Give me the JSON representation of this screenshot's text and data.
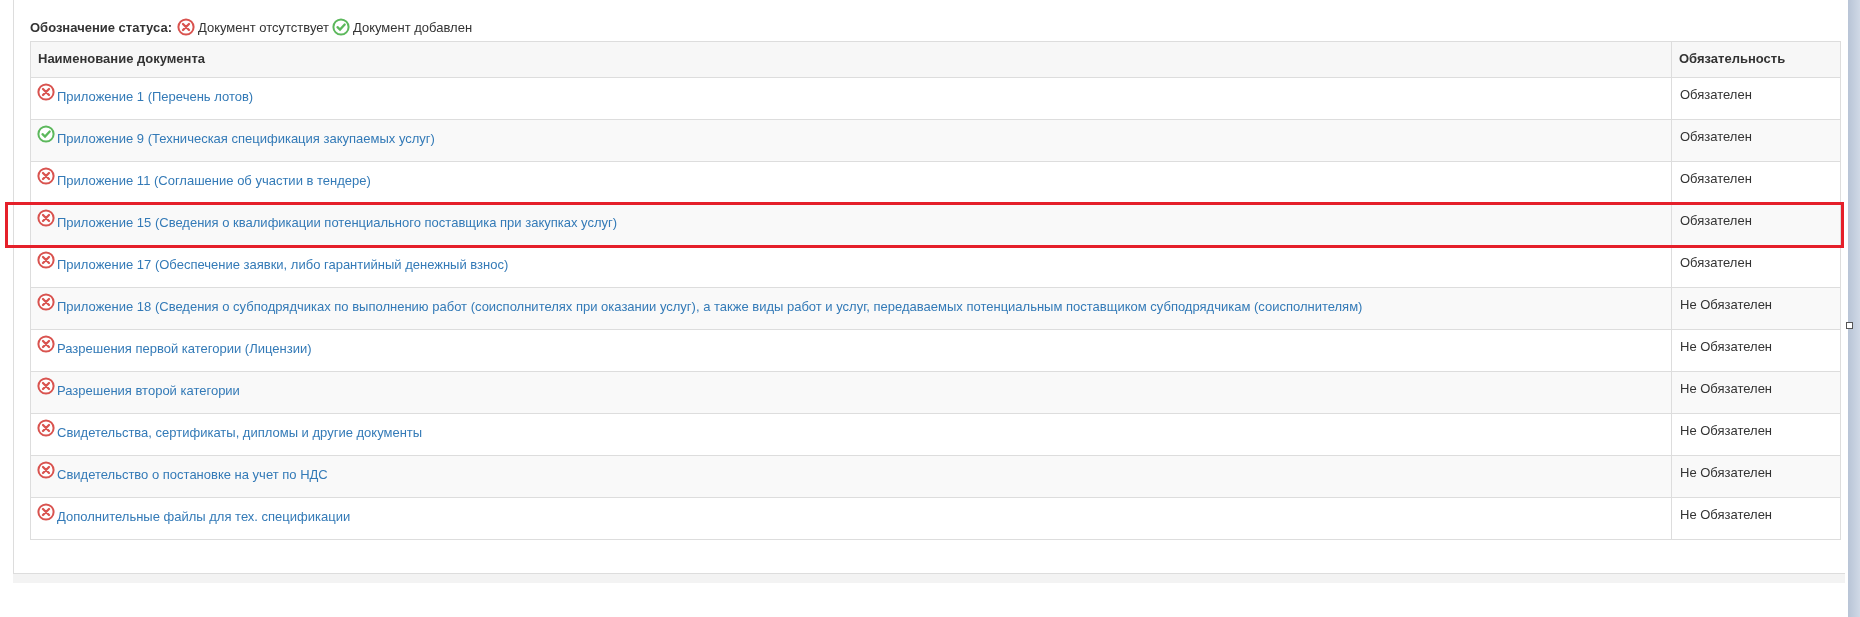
{
  "legend": {
    "label": "Обозначение статуса:",
    "items": [
      {
        "kind": "missing",
        "text": "Документ отсутствует"
      },
      {
        "kind": "added",
        "text": "Документ добавлен"
      }
    ]
  },
  "table": {
    "columns": [
      "Наименование документа",
      "Обязательность"
    ],
    "rows": [
      {
        "kind": "missing",
        "name": "Приложение 1 (Перечень лотов)",
        "required": "Обязателен",
        "highlighted": false
      },
      {
        "kind": "added",
        "name": "Приложение 9 (Техническая спецификация закупаемых услуг)",
        "required": "Обязателен",
        "highlighted": false
      },
      {
        "kind": "missing",
        "name": "Приложение 11 (Соглашение об участии в тендере)",
        "required": "Обязателен",
        "highlighted": false
      },
      {
        "kind": "missing",
        "name": "Приложение 15 (Сведения о квалификации потенциального поставщика при закупках услуг)",
        "required": "Обязателен",
        "highlighted": true
      },
      {
        "kind": "missing",
        "name": "Приложение 17 (Обеспечение заявки, либо гарантийный денежный взнос)",
        "required": "Обязателен",
        "highlighted": false
      },
      {
        "kind": "missing",
        "name": "Приложение 18 (Сведения о субподрядчиках по выполнению работ (соисполнителях при оказании услуг), а также виды работ и услуг, передаваемых потенциальным поставщиком субподрядчикам (соисполнителям)",
        "required": "Не Обязателен",
        "highlighted": false
      },
      {
        "kind": "missing",
        "name": "Разрешения первой категории (Лицензии)",
        "required": "Не Обязателен",
        "highlighted": false
      },
      {
        "kind": "missing",
        "name": "Разрешения второй категории",
        "required": "Не Обязателен",
        "highlighted": false
      },
      {
        "kind": "missing",
        "name": "Свидетельства, сертификаты, дипломы и другие документы",
        "required": "Не Обязателен",
        "highlighted": false
      },
      {
        "kind": "missing",
        "name": "Свидетельство о постановке на учет по НДС",
        "required": "Не Обязателен",
        "highlighted": false
      },
      {
        "kind": "missing",
        "name": "Дополнительные файлы для тех. спецификации",
        "required": "Не Обязателен",
        "highlighted": false
      }
    ]
  }
}
